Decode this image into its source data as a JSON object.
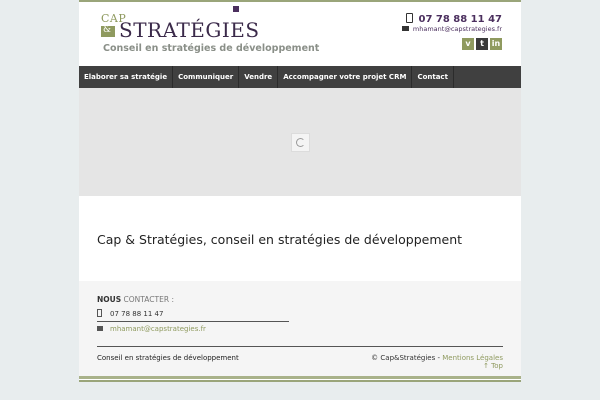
{
  "header": {
    "logo": {
      "cap": "CAP",
      "ampersand": "&",
      "strategies": "STRATÉGIES",
      "tagline": "Conseil en stratégies de développement"
    },
    "phone": "07 78 88 11 47",
    "email": "mhamant@capstrategies.fr",
    "social": [
      {
        "icon": "viadeo-icon",
        "glyph": "v"
      },
      {
        "icon": "twitter-icon",
        "glyph": "t"
      },
      {
        "icon": "linkedin-icon",
        "glyph": "in"
      }
    ]
  },
  "nav": {
    "items": [
      "Elaborer sa stratégie",
      "Communiquer",
      "Vendre",
      "Accompagner votre projet CRM",
      "Contact"
    ]
  },
  "main": {
    "title": "Cap & Stratégies, conseil en stratégies de développement"
  },
  "footer": {
    "heading_strong": "NOUS",
    "heading_rest": "CONTACTER :",
    "phone": "07 78 88 11 47",
    "email": "mhamant@capstrategies.fr",
    "tagline": "Conseil en stratégies de développement",
    "copyright": "© Cap&Stratégies -",
    "legal_link": "Mentions Légales",
    "top_link": "↑ Top"
  },
  "colors": {
    "accent_green": "#8f9a5f",
    "brand_purple": "#4b2f5e",
    "nav_bg": "#404040"
  }
}
